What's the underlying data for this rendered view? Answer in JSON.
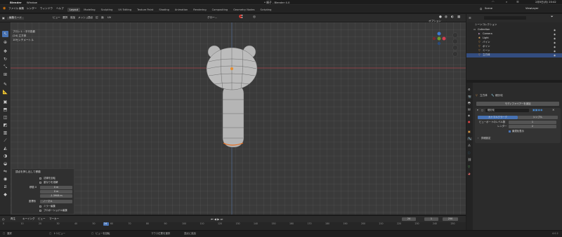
{
  "mac_menu": {
    "app_name": "Blender",
    "items": [
      "Window"
    ],
    "window_title": "* 棒子 - Blender 4.0",
    "clock": "2月5日(月) 20:42"
  },
  "topbar": {
    "menus": [
      "ファイル",
      "編集",
      "レンダー",
      "ウィンドウ",
      "ヘルプ"
    ],
    "workspace_tabs": [
      "Layout",
      "Modeling",
      "Sculpting",
      "UV Editing",
      "Texture Paint",
      "Shading",
      "Animation",
      "Rendering",
      "Compositing",
      "Geometry Nodes",
      "Scripting"
    ],
    "active_tab": "Layout",
    "scene_label": "Scene",
    "view_layer_label": "ViewLayer"
  },
  "viewport_header": {
    "mode": "編集モード",
    "menus": [
      "ビュー",
      "選択",
      "追加",
      "メッシュ",
      "頂点",
      "辺",
      "面",
      "UV"
    ],
    "orientation": "グロー...",
    "options": "オプション"
  },
  "viewport_overlay": {
    "line1": "プロント・平行投影",
    "line2": "(24) 立方体",
    "line3": "10センチメートル"
  },
  "outliner": {
    "title": "シーンコレクション",
    "items": [
      {
        "label": "Collection",
        "icon": "collection-icon"
      },
      {
        "label": "Camera",
        "icon": "camera-icon"
      },
      {
        "label": "Light",
        "icon": "light-icon"
      },
      {
        "label": "バイン",
        "icon": "mesh-icon"
      },
      {
        "label": "ボイン",
        "icon": "mesh-icon"
      },
      {
        "label": "ミーン",
        "icon": "mesh-icon"
      },
      {
        "label": "立方体",
        "icon": "mesh-icon"
      }
    ]
  },
  "properties": {
    "breadcrumb_obj": "立方体",
    "breadcrumb_mod": "細分化",
    "add_modifier": "モディファイアーを追加",
    "modifier_name": "細分化",
    "tab_catmull": "カトマルクラーク",
    "tab_simple": "シンプル",
    "viewport_levels_label": "ビューポートのレベル数",
    "viewport_levels": "1",
    "render_label": "レンダー",
    "render_value": "2",
    "optimal_label": "最適化表示",
    "advanced_label": "詳細設定"
  },
  "operator_panel": {
    "title": "頂点を押し出して移動",
    "opt1": "法線を反転",
    "opt2": "重なりを溶解",
    "move_label": "移動 X",
    "val_x": "0 m",
    "val_y": "0 m",
    "val_z": "-1.3908 m",
    "orient_label": "座標系",
    "orient_value": "ノーマル",
    "opt3": "ミラー編集",
    "opt4": "プロポーショナル編集"
  },
  "timeline": {
    "menus": [
      "再生",
      "キーイング",
      "ビュー",
      "マーカー"
    ],
    "current_frame": "24",
    "start": "1",
    "end": "250",
    "ticks": [
      "0",
      "10",
      "20",
      "30",
      "40",
      "50",
      "60",
      "70",
      "80",
      "90",
      "100",
      "110",
      "120",
      "130",
      "140",
      "150",
      "160",
      "170",
      "180",
      "190",
      "200",
      "210",
      "220",
      "230",
      "240",
      "250"
    ]
  },
  "statusbar": {
    "item1": "選択",
    "item2": "トリビュー",
    "item3": "ビューを回転",
    "item4": "マウス位置を選択",
    "item5": "頂点に追加",
    "version": "4.0.2"
  },
  "colors": {
    "accent": "#4772b3",
    "x_axis": "#d43d52",
    "y_axis": "#6a9a2a",
    "viewport_bg": "#3a3a3a"
  }
}
